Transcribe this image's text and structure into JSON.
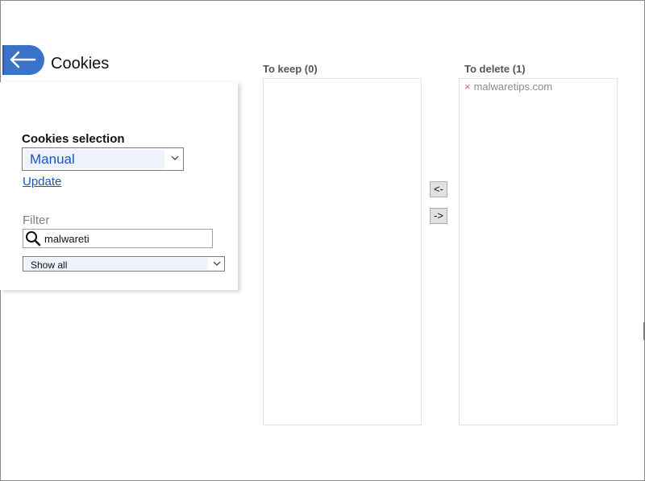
{
  "header": {
    "title": "Cookies",
    "back_icon": "arrow-left-icon",
    "accent_color": "#3a73c7"
  },
  "cookies_selection": {
    "label": "Cookies selection",
    "selected": "Manual",
    "update_link": "Update"
  },
  "filter": {
    "label": "Filter",
    "search_icon": "magnifier-icon",
    "value": "malwareti",
    "show_selected": "Show all"
  },
  "to_keep": {
    "header": "To keep (0)",
    "items": []
  },
  "to_delete": {
    "header": "To delete (1)",
    "items": [
      {
        "remove_glyph": "×",
        "label": "malwaretips.com"
      }
    ]
  },
  "move_buttons": {
    "to_keep": "<-",
    "to_delete": "->"
  }
}
